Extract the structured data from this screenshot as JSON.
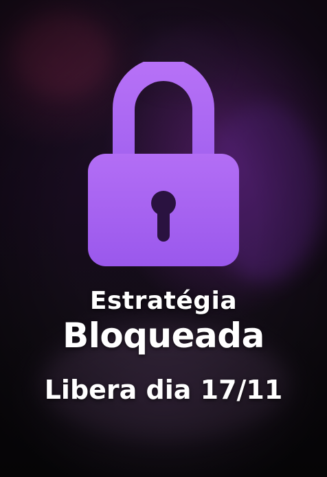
{
  "overlay": {
    "title_line1": "Estratégia",
    "title_line2": "Bloqueada",
    "release_text": "Libera dia 17/11",
    "lock_icon": "padlock-icon",
    "colors": {
      "lock_purple_top": "#b36ef5",
      "lock_purple_bottom": "#9a58ec",
      "keyhole": "#2a1240",
      "text": "#ffffff"
    }
  }
}
